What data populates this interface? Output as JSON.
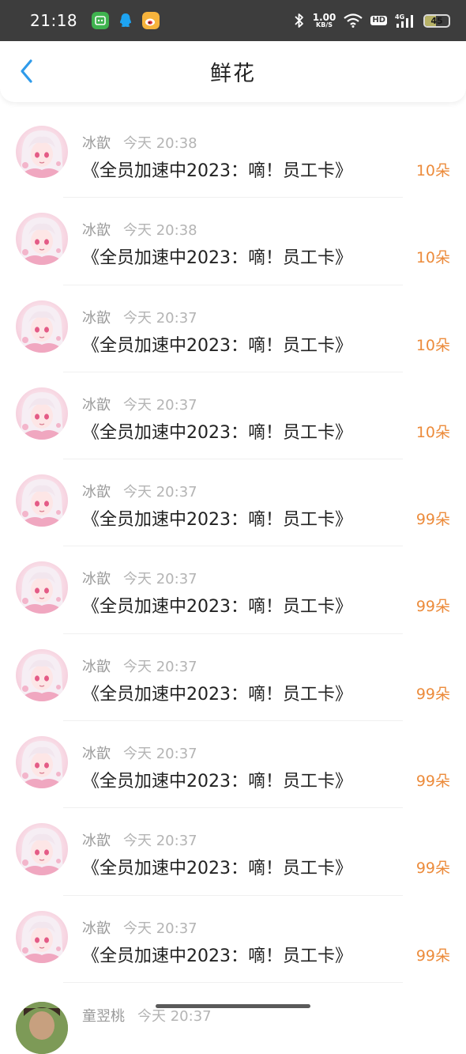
{
  "status_bar": {
    "time": "21:18",
    "net_speed": "1.00",
    "net_unit": "KB/S",
    "hd": "HD",
    "signal": "4G",
    "battery": "45",
    "battery_level": 45,
    "app_icons": [
      "wechat-icon",
      "qq-icon",
      "weibo-icon"
    ]
  },
  "nav": {
    "title": "鲜花",
    "back_icon": "chevron-left-icon",
    "accent": "#2f9bea"
  },
  "count_color": "#ec8b3b",
  "items": [
    {
      "name": "冰歆",
      "time": "今天 20:38",
      "gift": "《全员加速中2023：嘀！员工卡》",
      "count": "10朵"
    },
    {
      "name": "冰歆",
      "time": "今天 20:38",
      "gift": "《全员加速中2023：嘀！员工卡》",
      "count": "10朵"
    },
    {
      "name": "冰歆",
      "time": "今天 20:37",
      "gift": "《全员加速中2023：嘀！员工卡》",
      "count": "10朵"
    },
    {
      "name": "冰歆",
      "time": "今天 20:37",
      "gift": "《全员加速中2023：嘀！员工卡》",
      "count": "10朵"
    },
    {
      "name": "冰歆",
      "time": "今天 20:37",
      "gift": "《全员加速中2023：嘀！员工卡》",
      "count": "99朵"
    },
    {
      "name": "冰歆",
      "time": "今天 20:37",
      "gift": "《全员加速中2023：嘀！员工卡》",
      "count": "99朵"
    },
    {
      "name": "冰歆",
      "time": "今天 20:37",
      "gift": "《全员加速中2023：嘀！员工卡》",
      "count": "99朵"
    },
    {
      "name": "冰歆",
      "time": "今天 20:37",
      "gift": "《全员加速中2023：嘀！员工卡》",
      "count": "99朵"
    },
    {
      "name": "冰歆",
      "time": "今天 20:37",
      "gift": "《全员加速中2023：嘀！员工卡》",
      "count": "99朵"
    },
    {
      "name": "冰歆",
      "time": "今天 20:37",
      "gift": "《全员加速中2023：嘀！员工卡》",
      "count": "99朵"
    }
  ],
  "partial_item": {
    "name": "童翌桃",
    "time": "今天 20:37"
  }
}
